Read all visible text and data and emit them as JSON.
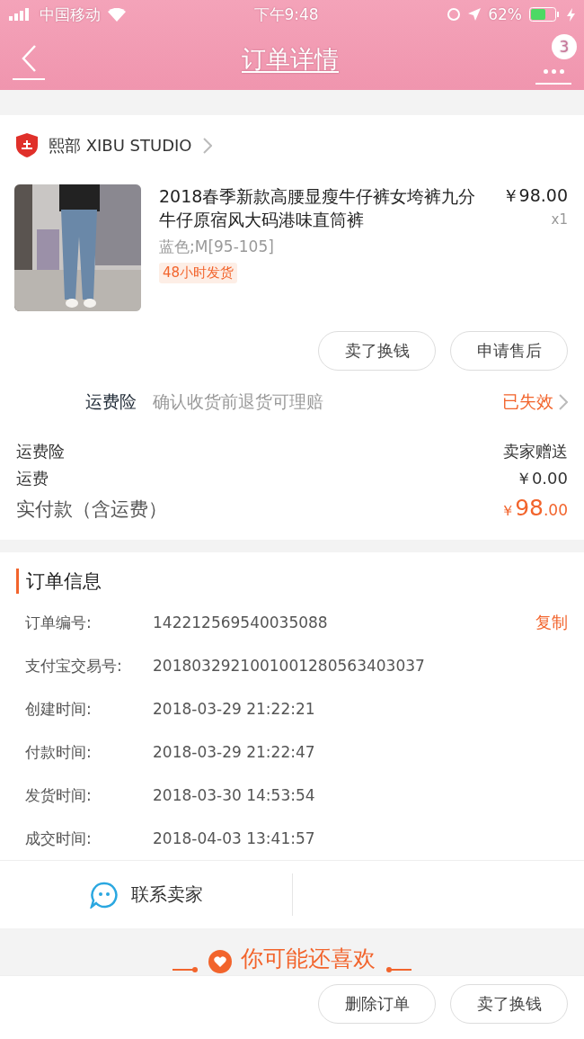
{
  "status_bar": {
    "carrier": "中国移动",
    "time": "下午9:48",
    "battery": "62%"
  },
  "nav": {
    "title": "订单详情",
    "badge": "3"
  },
  "shop": {
    "name": "熙部 XIBU STUDIO"
  },
  "product": {
    "title": "2018春季新款高腰显瘦牛仔裤女垮裤九分牛仔原宿风大码港味直筒裤",
    "price": "￥98.00",
    "quantity": "x1",
    "spec": "蓝色;M[95-105]",
    "tag": "48小时发货"
  },
  "item_actions": [
    "卖了换钱",
    "申请售后"
  ],
  "insurance": {
    "label": "运费险",
    "description": "确认收货前退货可理赔",
    "status": "已失效"
  },
  "fees": [
    {
      "label": "运费险",
      "value": "卖家赠送"
    },
    {
      "label": "运费",
      "value": "￥0.00"
    }
  ],
  "total": {
    "label": "实付款（含运费）",
    "currency": "￥",
    "integer": "98",
    "decimal": ".00"
  },
  "order_info": {
    "title": "订单信息",
    "copy": "复制",
    "rows": [
      {
        "label": "订单编号:",
        "value": "142212569540035088"
      },
      {
        "label": "支付宝交易号:",
        "value": "2018032921001001280563403037"
      },
      {
        "label": "创建时间:",
        "value": "2018-03-29 21:22:21"
      },
      {
        "label": "付款时间:",
        "value": "2018-03-29 21:22:47"
      },
      {
        "label": "发货时间:",
        "value": "2018-03-30 14:53:54"
      },
      {
        "label": "成交时间:",
        "value": "2018-04-03 13:41:57"
      }
    ]
  },
  "contact": {
    "label": "联系卖家"
  },
  "recommend": {
    "title": "你可能还喜欢"
  },
  "bottom_actions": [
    "删除订单",
    "卖了换钱"
  ]
}
